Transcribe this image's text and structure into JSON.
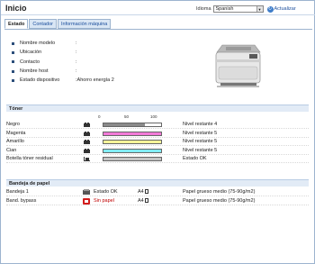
{
  "header": {
    "title": "Inicio",
    "language_label": "Idioma",
    "language_value": "Spanish",
    "refresh_label": "Actualizar"
  },
  "tabs": [
    {
      "label": "Estado"
    },
    {
      "label": "Contador"
    },
    {
      "label": "Información máquina"
    }
  ],
  "device_info": [
    {
      "label": "Nombre modelo",
      "value": ":"
    },
    {
      "label": "Ubicación",
      "value": ":"
    },
    {
      "label": "Contacto",
      "value": ":"
    },
    {
      "label": "Nombre host",
      "value": ":"
    },
    {
      "label": "Estado dispositivo",
      "value": ":Ahorro energía 2"
    }
  ],
  "toner": {
    "section_title": "Tóner",
    "scale": [
      "0",
      "50",
      "100"
    ],
    "items": [
      {
        "name": "Negro",
        "level": 0.72,
        "color": "#8a8a8a",
        "status": "Nivel restante 4"
      },
      {
        "name": "Magenta",
        "level": 1.0,
        "color": "#f27ad8",
        "status": "Nivel restante 5"
      },
      {
        "name": "Amarillo",
        "level": 1.0,
        "color": "#f8f59a",
        "status": "Nivel restante 5"
      },
      {
        "name": "Cian",
        "level": 1.0,
        "color": "#82ecf4",
        "status": "Nivel restante 5"
      },
      {
        "name": "Botella tóner residual",
        "level": 1.0,
        "color": "#c4c4c4",
        "status": "Estado OK"
      }
    ]
  },
  "trays": {
    "section_title": "Bandeja de papel",
    "items": [
      {
        "name": "Bandeja 1",
        "status": "Estado OK",
        "status_color": "#222222",
        "icon_color": "#555555",
        "size": "A4",
        "type": "Papel grueso medio (75-90g/m2)"
      },
      {
        "name": "Band. bypass",
        "status": "Sin papel",
        "status_color": "#c00000",
        "icon_color": "#d21c1c",
        "size": "A4",
        "type": "Papel grueso medio (75-90g/m2)"
      }
    ]
  }
}
